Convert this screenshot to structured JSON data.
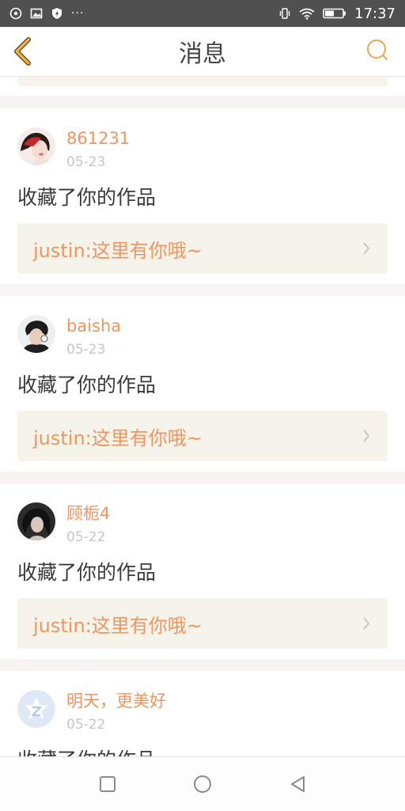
{
  "status_bar": {
    "time": "17:37",
    "icons": [
      "sync-circle-icon",
      "image-icon",
      "shield-icon",
      "more-dots-icon",
      "vibrate-icon",
      "wifi-icon",
      "battery-icon"
    ],
    "dots": "···"
  },
  "header": {
    "title": "消息",
    "back_icon": "chevron-left-icon",
    "search_icon": "search-icon",
    "accent": "#f0a24f"
  },
  "messages": [
    {
      "username": "861231",
      "date": "05-23",
      "action": "收藏了你的作品",
      "quote": "justin:这里有你哦~"
    },
    {
      "username": "baisha",
      "date": "05-23",
      "action": "收藏了你的作品",
      "quote": "justin:这里有你哦~"
    },
    {
      "username": "顾栀4",
      "date": "05-22",
      "action": "收藏了你的作品",
      "quote": "justin:这里有你哦~"
    },
    {
      "username": "明天，更美好",
      "date": "05-22",
      "action": "收藏了你的作品"
    }
  ],
  "colors": {
    "username": "#ef955f",
    "date": "#c6c6c6",
    "quote_bg": "#f5f3ea",
    "page_bg": "#f7f4f3"
  },
  "nav": {
    "icons": [
      "square-recent-icon",
      "circle-home-icon",
      "triangle-back-icon"
    ]
  }
}
